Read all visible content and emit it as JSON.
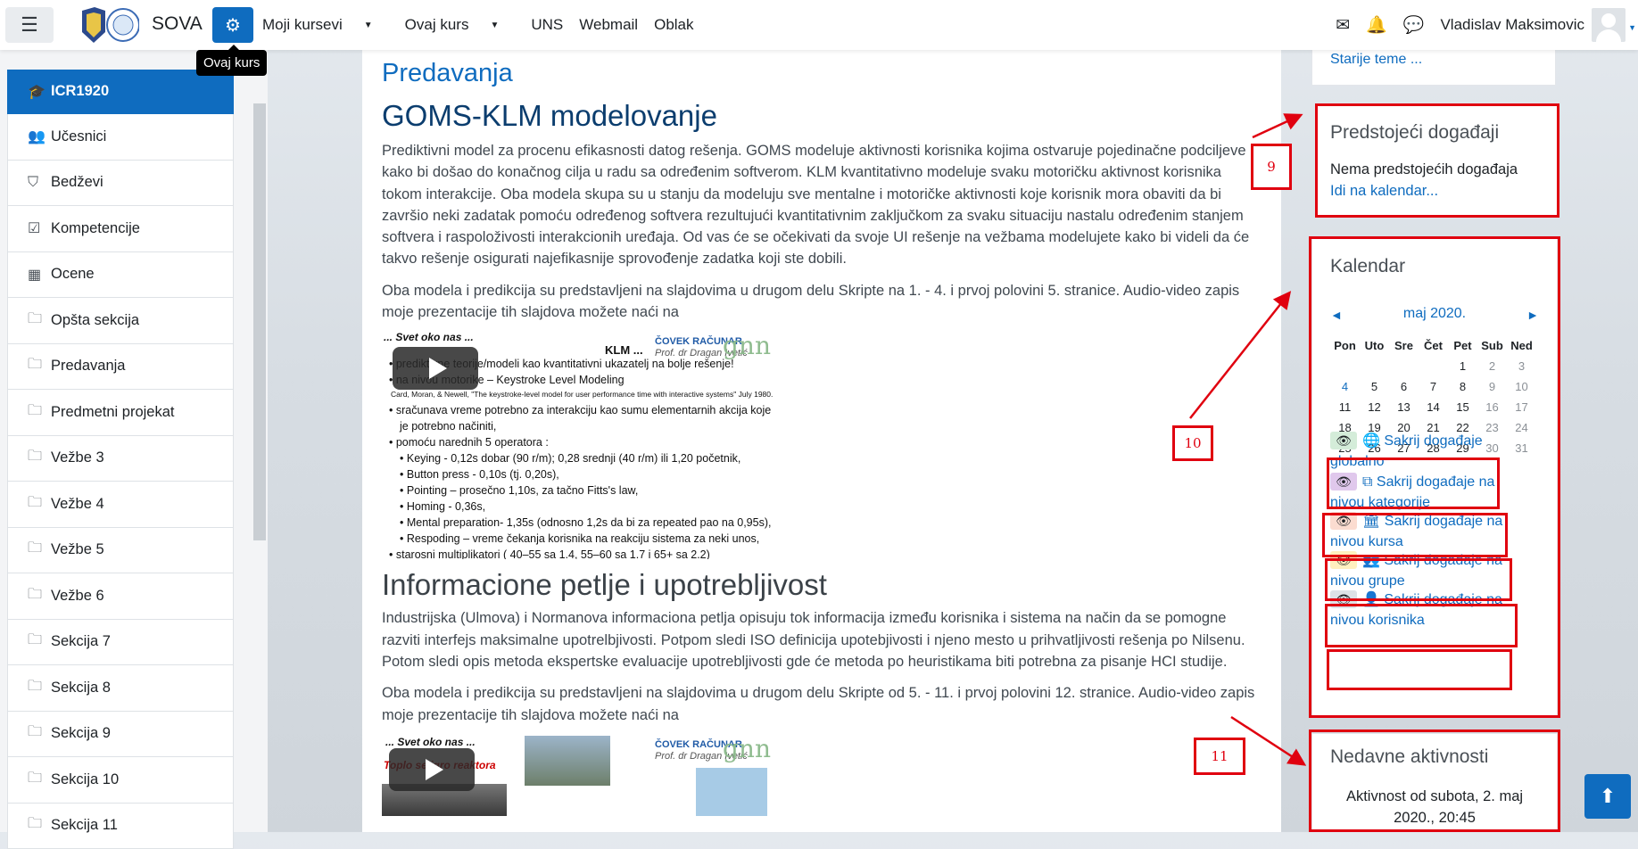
{
  "navbar": {
    "brand": "SOVA",
    "tooltip": "Ovaj kurs",
    "links": [
      "Moji kursevi",
      "Ovaj kurs",
      "UNS",
      "Webmail",
      "Oblak"
    ],
    "user_name": "Vladislav Maksimovic"
  },
  "drawer": {
    "course": "ICR1920",
    "items": [
      "Učesnici",
      "Bedževi",
      "Kompetencije",
      "Ocene",
      "Opšta sekcija",
      "Predavanja",
      "Predmetni projekat",
      "Vežbe 3",
      "Vežbe 4",
      "Vežbe 5",
      "Vežbe 6",
      "Sekcija 7",
      "Sekcija 8",
      "Sekcija 9",
      "Sekcija 10",
      "Sekcija 11"
    ]
  },
  "main": {
    "section_title": "Predavanja",
    "topic1": {
      "title": "GOMS-KLM modelovanje",
      "p1": "Prediktivni model za procenu efikasnosti datog rešenja. GOMS modeluje aktivnosti korisnika kojima ostvaruje pojedinačne podciljeve kako bi došao do konačnog cilja u radu sa određenim softverom. KLM kvantitativno modeluje svaku motoričku aktivnost korisnika tokom interakcije. Oba modela skupa su u stanju da modeluju sve mentalne i motoričke aktivnosti koje korisnik mora obaviti da bi završio neki zadatak pomoću određenog softvera rezultujući kvantitativnim zaključkom za svaku situaciju nastalu određenim stanjem softvera i raspoloživosti interakcionih uređaja. Od vas će se očekivati da svoje UI rešenje na vežbama modelujete kako bi videli da će takvo rešenje osigurati najefikasnije sprovođenje zadatka koji ste dobili.",
      "p2": "Oba modela i predikcija su predstavljeni na slajdovima u drugom delu Skripte na 1. - 4. i prvoj polovini 5. stranice. Audio-video zapis moje prezentacije tih slajdova možete naći na",
      "slide": {
        "top_left": "... Svet oko nas ...",
        "heading": "KLM ...",
        "logo_line1": "ČOVEK RAČUNAR",
        "logo_line2": "Prof. dr Dragan Ivetić",
        "bullets": [
          "prediktivne teorije/modeli kao kvantitativni ukazatelj na bolje rešenje!",
          "na nivou motorike – Keystroke Level Modeling",
          "Card, Moran, & Newell, \"The keystroke-level model for user performance time with interactive systems\" July 1980.",
          "sračunava vreme potrebno za interakciju kao sumu elementarnih akcija koje",
          "je potrebno načiniti,",
          "pomoću narednih 5 operatora :",
          "Keying - 0,12s dobar (90 r/m); 0,28 srednji (40 r/m) ili 1,20 početnik,",
          "Button press - 0,10s (tj. 0,20s),",
          "Pointing – prosečno 1,10s, za tačno Fitts's law,",
          "Homing - 0,36s,",
          "Mental preparation- 1,35s (odnosno 1,2s da bi za repeated pao na 0,95s),",
          "Respoding – vreme čekanja korisnika na reakciju sistema  za neki unos,",
          "starosni multiplikatori ( 40–55 sa 1.4, 55–60 sa 1.7 i 65+ sa 2.2)"
        ]
      }
    },
    "topic2": {
      "title": "Informacione petlje i upotrebljivost",
      "p1": "Industrijska (Ulmova) i Normanova informaciona petlja opisuju tok informacija između korisnika i sistema na način da se pomogne razviti interfejs maksimalne upotrelbjivosti. Potpom sledi ISO definicija upotebjivosti i njeno mesto u prihvatljivosti rešenja po Nilsenu. Potom sledi opis metoda ekspertske evaluacije upotrebljivosti gde će metoda po heuristikama biti potrebna za pisanje HCI studije.",
      "p2": "Oba modela i predikcija su predstavljeni na slajdovima u drugom delu Skripte od 5. - 11. i prvoj polovini 12. stranice. Audio-video zapis moje prezentacije tih slajdova možete naći na",
      "slide": {
        "top_left": "... Svet oko nas ...",
        "caption": "Toplo se igro reaktora",
        "logo_line1": "ČOVEK RAČUNAR",
        "logo_line2": "Prof. dr Dragan Ivetić"
      }
    }
  },
  "right": {
    "older_topics": "Starije teme ...",
    "upcoming": {
      "title": "Predstojeći događaji",
      "none": "Nema predstojećih događaja",
      "calendar_link": "Idi na kalendar..."
    },
    "calendar": {
      "title": "Kalendar",
      "month": "maj 2020.",
      "prev": "◄",
      "next": "►",
      "days": [
        "Pon",
        "Uto",
        "Sre",
        "Čet",
        "Pet",
        "Sub",
        "Ned"
      ],
      "weeks": [
        [
          "",
          "",
          "",
          "",
          "1",
          "2",
          "3"
        ],
        [
          "4",
          "5",
          "6",
          "7",
          "8",
          "9",
          "10"
        ],
        [
          "11",
          "12",
          "13",
          "14",
          "15",
          "16",
          "17"
        ],
        [
          "18",
          "19",
          "20",
          "21",
          "22",
          "23",
          "24"
        ],
        [
          "25",
          "26",
          "27",
          "28",
          "29",
          "30",
          "31"
        ]
      ],
      "today": "4",
      "hide_links": [
        {
          "line1": "Sakrij događaje",
          "line2": "globalno",
          "icon": "globe-icon",
          "color": "#d4ecd9"
        },
        {
          "line1": "Sakrij događaje na",
          "line2": "nivou kategorije",
          "icon": "cubes-icon",
          "color": "#e0c8ec"
        },
        {
          "line1": "Sakrij događaje na",
          "line2": "nivou kursa",
          "icon": "bank-icon",
          "color": "#fbdcd0"
        },
        {
          "line1": "Sakrij događaje na",
          "line2": "nivou grupe",
          "icon": "users-icon",
          "color": "#fff0bf"
        },
        {
          "line1": "Sakrij događaje na",
          "line2": "nivou korisnika",
          "icon": "user-icon",
          "color": "#dde2e6"
        }
      ]
    },
    "recent": {
      "title": "Nedavne aktivnosti",
      "since_line1": "Aktivnost od subota, 2. maj",
      "since_line2": "2020., 20:45"
    }
  },
  "annotations": {
    "n9": "9",
    "n10": "10",
    "n11": "11",
    "color": "#e0000f"
  }
}
